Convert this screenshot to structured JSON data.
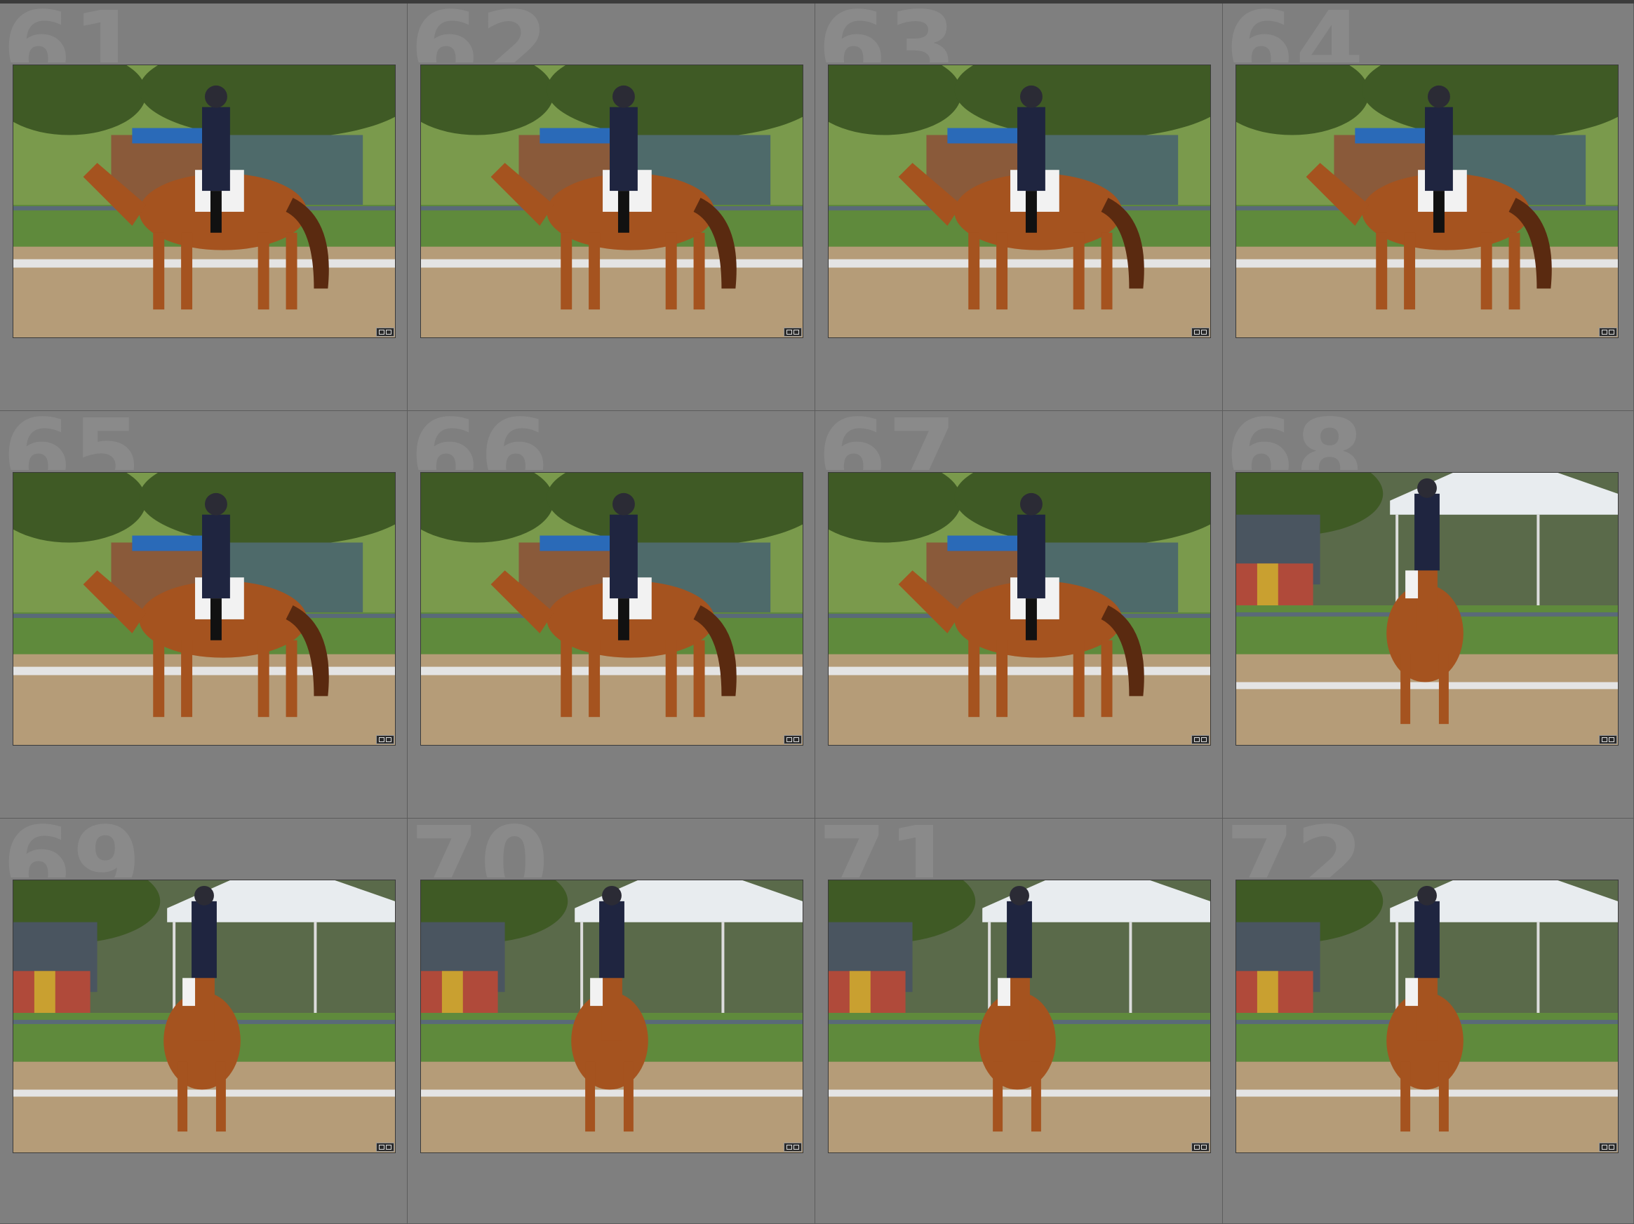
{
  "grid": {
    "cells": [
      {
        "index": "61",
        "scene": "arena-side"
      },
      {
        "index": "62",
        "scene": "arena-side"
      },
      {
        "index": "63",
        "scene": "arena-side"
      },
      {
        "index": "64",
        "scene": "arena-side"
      },
      {
        "index": "65",
        "scene": "arena-side"
      },
      {
        "index": "66",
        "scene": "arena-side"
      },
      {
        "index": "67",
        "scene": "arena-side"
      },
      {
        "index": "68",
        "scene": "arena-front"
      },
      {
        "index": "69",
        "scene": "arena-front"
      },
      {
        "index": "70",
        "scene": "arena-front"
      },
      {
        "index": "71",
        "scene": "arena-front"
      },
      {
        "index": "72",
        "scene": "arena-front"
      }
    ]
  },
  "badge_icon": "edit-badge-icon",
  "colors": {
    "background": "#7f7f7f",
    "sand": "#b59c78",
    "grass": "#5f8a3c",
    "trees": "#3f5a25",
    "horse": "#a5531f",
    "rider_jacket": "#1f2540",
    "fence": "#5a6a78",
    "tent": "#e8ecef"
  }
}
